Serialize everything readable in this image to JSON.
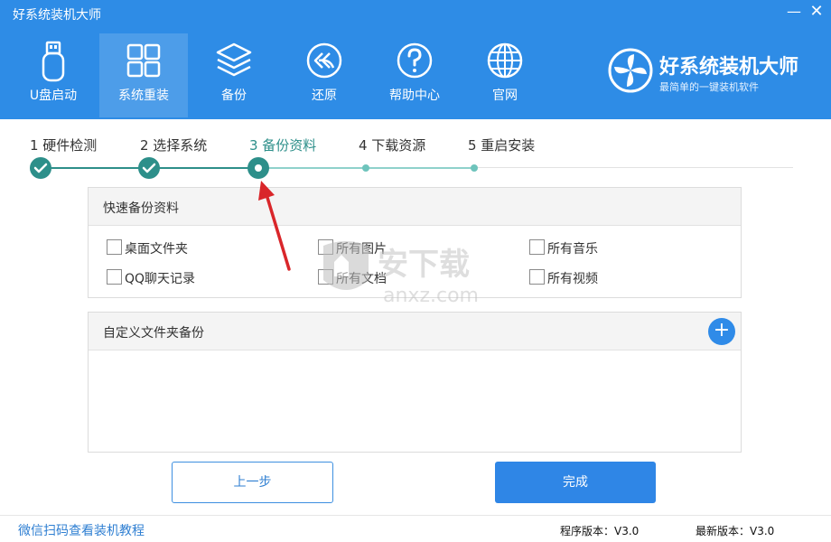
{
  "window": {
    "title": "好系统装机大师",
    "minimize": "—",
    "close": "✕"
  },
  "nav": [
    {
      "label": "U盘启动",
      "icon": "usb-drive-icon"
    },
    {
      "label": "系统重装",
      "icon": "windows-grid-icon",
      "active": true
    },
    {
      "label": "备份",
      "icon": "layers-icon"
    },
    {
      "label": "还原",
      "icon": "restore-icon"
    },
    {
      "label": "帮助中心",
      "icon": "help-icon"
    },
    {
      "label": "官网",
      "icon": "globe-icon"
    }
  ],
  "brand": {
    "name": "好系统装机大师",
    "slogan": "最简单的一键装机软件",
    "logo_icon": "pinwheel-logo-icon"
  },
  "steps": [
    {
      "label": "1  硬件检测",
      "status": "done"
    },
    {
      "label": "2  选择系统",
      "status": "done"
    },
    {
      "label": "3  备份资料",
      "status": "current"
    },
    {
      "label": "4  下载资源",
      "status": "pending"
    },
    {
      "label": "5  重启安装",
      "status": "pending"
    }
  ],
  "quick_backup": {
    "title": "快速备份资料",
    "options": [
      {
        "label": "桌面文件夹",
        "checked": false
      },
      {
        "label": "所有图片",
        "checked": false
      },
      {
        "label": "所有音乐",
        "checked": false
      },
      {
        "label": "QQ聊天记录",
        "checked": false
      },
      {
        "label": "所有文档",
        "checked": false
      },
      {
        "label": "所有视频",
        "checked": false
      }
    ]
  },
  "custom_backup": {
    "title": "自定义文件夹备份",
    "add_symbol": "+"
  },
  "watermark": {
    "text": "安下载",
    "domain": "anxz.com"
  },
  "buttons": {
    "prev": "上一步",
    "done": "完成"
  },
  "footer": {
    "link": "微信扫码查看装机教程",
    "program_version": "程序版本：V3.0",
    "latest_version": "最新版本：V3.0"
  },
  "colors": {
    "header": "#2e8ce6",
    "step_accent": "#2d8f8a",
    "primary_button": "#2f86e6",
    "annotation_arrow": "#d9262a"
  }
}
